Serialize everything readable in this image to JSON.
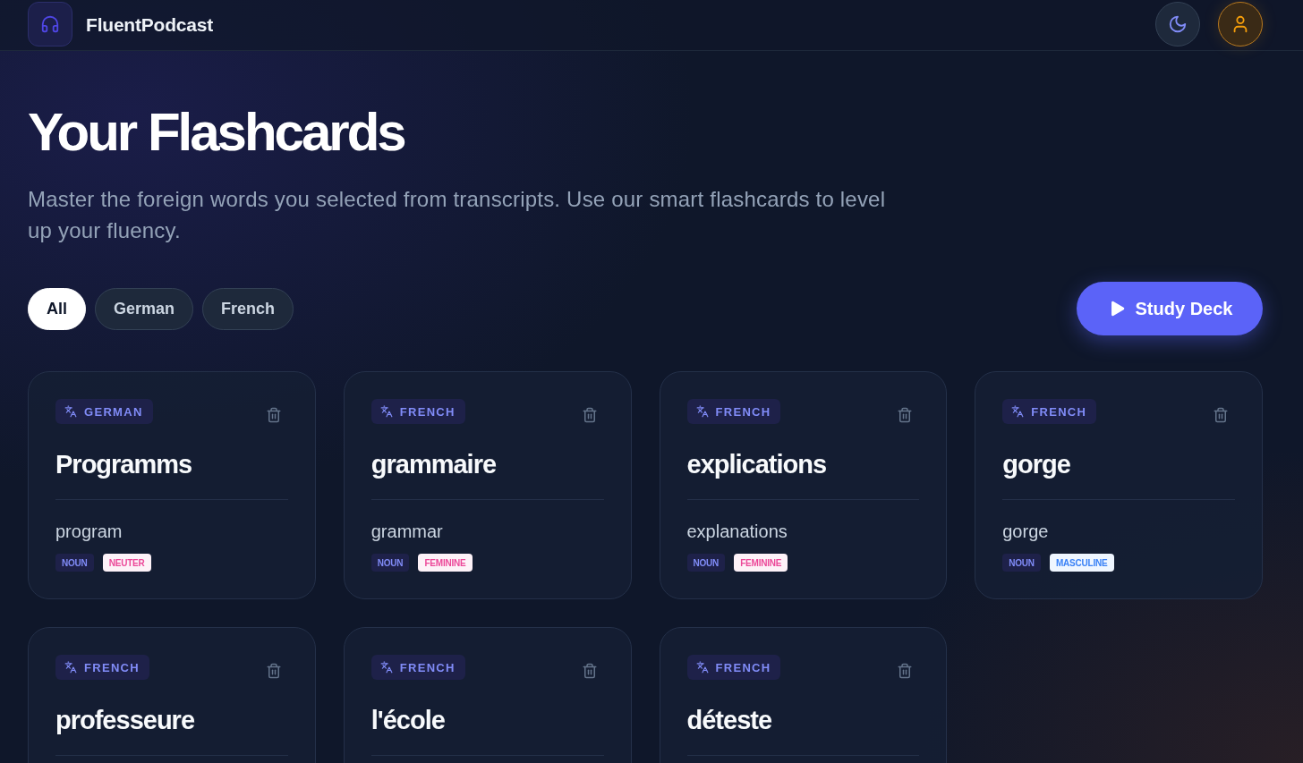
{
  "header": {
    "brand": "FluentPodcast"
  },
  "page": {
    "title": "Your Flashcards",
    "subtitle": "Master the foreign words you selected from transcripts. Use our smart flashcards to level up your fluency."
  },
  "filters": [
    {
      "label": "All",
      "selected": true
    },
    {
      "label": "German",
      "selected": false
    },
    {
      "label": "French",
      "selected": false
    }
  ],
  "study_button": {
    "label": "Study Deck"
  },
  "cards": [
    {
      "language": "GERMAN",
      "word": "Programms",
      "translation": "program",
      "tags": [
        {
          "label": "NOUN",
          "kind": "part_of_speech",
          "color": "#818cf8"
        },
        {
          "label": "NEUTER",
          "kind": "gender",
          "color": "#ec4899"
        }
      ]
    },
    {
      "language": "FRENCH",
      "word": "grammaire",
      "translation": "grammar",
      "tags": [
        {
          "label": "NOUN",
          "kind": "part_of_speech",
          "color": "#818cf8"
        },
        {
          "label": "FEMININE",
          "kind": "gender",
          "color": "#ec4899"
        }
      ]
    },
    {
      "language": "FRENCH",
      "word": "explications",
      "translation": "explanations",
      "tags": [
        {
          "label": "NOUN",
          "kind": "part_of_speech",
          "color": "#818cf8"
        },
        {
          "label": "FEMININE",
          "kind": "gender",
          "color": "#ec4899"
        }
      ]
    },
    {
      "language": "FRENCH",
      "word": "gorge",
      "translation": "gorge",
      "tags": [
        {
          "label": "NOUN",
          "kind": "part_of_speech",
          "color": "#818cf8"
        },
        {
          "label": "MASCULINE",
          "kind": "gender",
          "color": "#3b82f6"
        }
      ]
    },
    {
      "language": "FRENCH",
      "word": "professeure"
    },
    {
      "language": "FRENCH",
      "word": "l'école"
    },
    {
      "language": "FRENCH",
      "word": "déteste"
    }
  ]
}
